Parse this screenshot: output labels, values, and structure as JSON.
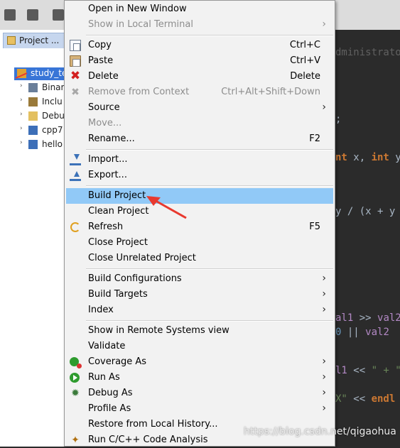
{
  "explorer": {
    "tab_label": "Project ...",
    "tree": [
      {
        "label": "study_te",
        "selected": true,
        "icon": "project-icon"
      },
      {
        "label": "Binar",
        "icon": "binaries-icon"
      },
      {
        "label": "Inclu",
        "icon": "includes-icon"
      },
      {
        "label": "Debu",
        "icon": "folder-icon"
      },
      {
        "label": "cpp7",
        "icon": "cpp-file-icon"
      },
      {
        "label": "hello",
        "icon": "cpp-file-icon"
      }
    ]
  },
  "editor": {
    "lines": [
      {
        "tokens": [
          {
            "t": "dministrato",
            "c": "fade"
          }
        ]
      },
      {
        "tokens": [
          {
            "t": ";",
            "c": "op"
          }
        ]
      },
      {
        "tokens": [
          {
            "t": "nt",
            "c": "kw"
          },
          {
            "t": " x, ",
            "c": "op"
          },
          {
            "t": "int",
            "c": "kw"
          },
          {
            "t": " y",
            "c": "op"
          }
        ]
      },
      {
        "tokens": [
          {
            "t": " y / (x + y",
            "c": "op"
          }
        ]
      },
      {
        "tokens": [
          {
            "t": "al1",
            "c": "purple"
          },
          {
            "t": " >> ",
            "c": "op"
          },
          {
            "t": "val2",
            "c": "purple"
          }
        ]
      },
      {
        "tokens": [
          {
            "t": " 0",
            "c": "num"
          },
          {
            "t": " || ",
            "c": "op"
          },
          {
            "t": "val2",
            "c": "purple"
          }
        ]
      },
      {
        "tokens": [
          {
            "t": "l1",
            "c": "purple"
          },
          {
            "t": " << ",
            "c": "op"
          },
          {
            "t": "\" + \"",
            "c": "str"
          }
        ]
      },
      {
        "tokens": [
          {
            "t": "X\"",
            "c": "str"
          },
          {
            "t": " << ",
            "c": "op"
          },
          {
            "t": "endl",
            "c": "kw"
          }
        ]
      }
    ]
  },
  "context_menu": {
    "items": [
      {
        "label": "Open in New Window"
      },
      {
        "label": "Show in Local Terminal",
        "submenu": true,
        "disabled": true
      },
      {
        "separator": true
      },
      {
        "label": "Copy",
        "accel": "Ctrl+C",
        "icon": "copy-icon"
      },
      {
        "label": "Paste",
        "accel": "Ctrl+V",
        "icon": "paste-icon"
      },
      {
        "label": "Delete",
        "accel": "Delete",
        "icon": "delete-icon"
      },
      {
        "label": "Remove from Context",
        "accel": "Ctrl+Alt+Shift+Down",
        "icon": "remove-context-icon",
        "disabled": true
      },
      {
        "label": "Source",
        "submenu": true
      },
      {
        "label": "Move...",
        "disabled": true
      },
      {
        "label": "Rename...",
        "accel": "F2"
      },
      {
        "separator": true
      },
      {
        "label": "Import...",
        "icon": "import-icon"
      },
      {
        "label": "Export...",
        "icon": "export-icon"
      },
      {
        "separator": true
      },
      {
        "label": "Build Project",
        "highlighted": true
      },
      {
        "label": "Clean Project"
      },
      {
        "label": "Refresh",
        "accel": "F5",
        "icon": "refresh-icon"
      },
      {
        "label": "Close Project"
      },
      {
        "label": "Close Unrelated Project"
      },
      {
        "separator": true
      },
      {
        "label": "Build Configurations",
        "submenu": true
      },
      {
        "label": "Build Targets",
        "submenu": true
      },
      {
        "label": "Index",
        "submenu": true
      },
      {
        "separator": true
      },
      {
        "label": "Show in Remote Systems view"
      },
      {
        "label": "Validate"
      },
      {
        "label": "Coverage As",
        "submenu": true,
        "icon": "coverage-icon"
      },
      {
        "label": "Run As",
        "submenu": true,
        "icon": "run-icon"
      },
      {
        "label": "Debug As",
        "submenu": true,
        "icon": "debug-icon"
      },
      {
        "label": "Profile As",
        "submenu": true
      },
      {
        "label": "Restore from Local History..."
      },
      {
        "label": "Run C/C++ Code Analysis",
        "icon": "code-analysis-icon"
      }
    ],
    "submenu_arrow": "›"
  },
  "watermark": "https://blog.csdn.net/qigaohua",
  "colors": {
    "highlight": "#91c9f7",
    "annotation_arrow": "#e8392f"
  }
}
